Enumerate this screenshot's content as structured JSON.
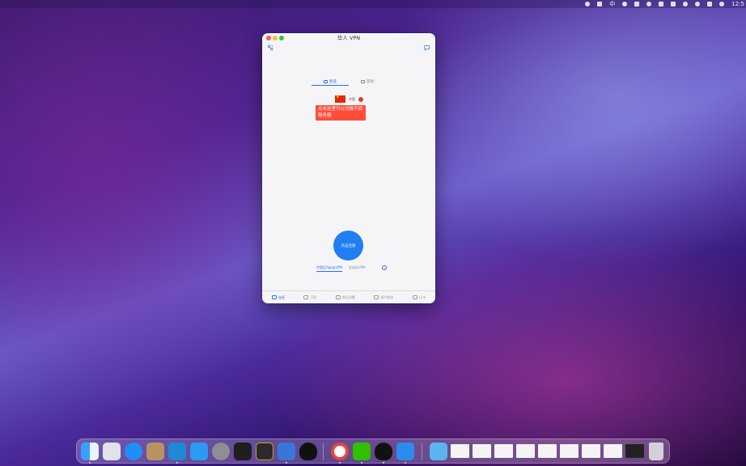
{
  "menubar": {
    "input_method": "中",
    "clock": "12:5"
  },
  "window": {
    "title": "华人 VPN"
  },
  "segment": {
    "tab1": "智选",
    "tab2": "游戏"
  },
  "server": {
    "name": "中国"
  },
  "tooltip": "点击这里可以切换不同服务器",
  "connect_label": "点击连接",
  "modes": [
    "中国区App走VPN",
    "全局走VPN"
  ],
  "info_icon": "i",
  "bottom_nav": [
    "连接",
    "订阅",
    "常见问题",
    "客户服务",
    "Link"
  ],
  "icons": {
    "top_left": "link-icon",
    "top_right": "chat-icon",
    "apps": [
      "finder",
      "launchpad",
      "safari",
      "notes",
      "vscode",
      "app-store",
      "system-preferences",
      "terminal",
      "console",
      "notes2",
      "qq",
      "chrome",
      "wechat",
      "qq",
      "huaren-vpn",
      "folder",
      "trash"
    ]
  },
  "colors": {
    "accent": "#2a6ef0",
    "tooltip": "#ff4d3a",
    "connect": "#1f7ff3"
  }
}
